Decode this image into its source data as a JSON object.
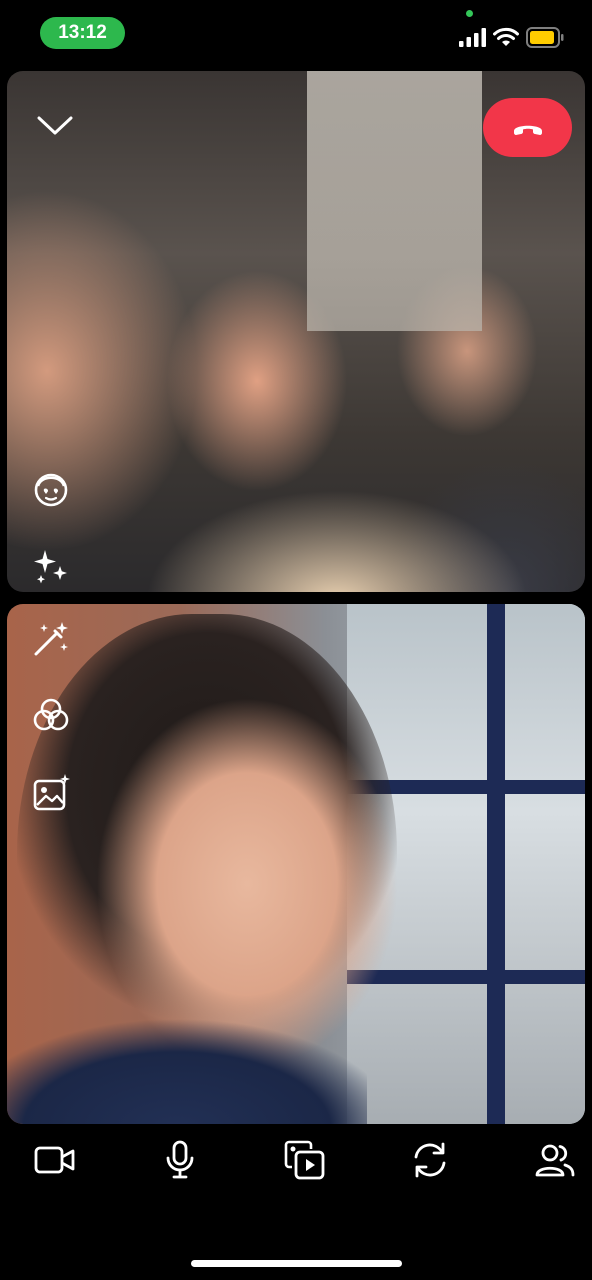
{
  "status_bar": {
    "time": "13:12",
    "icons": [
      "signal-icon",
      "wifi-icon",
      "battery-icon"
    ],
    "time_pill_color": "#2db84d",
    "battery_color": "#ffcc00"
  },
  "call": {
    "end_call_color": "#f23649",
    "tiles": [
      {
        "name": "group-video-feed",
        "icons": [
          "collapse-chevron-icon",
          "phone-hangup-icon",
          "lens-face-icon",
          "sparkles-icon"
        ]
      },
      {
        "name": "self-video-feed",
        "icons": [
          "magic-wand-icon",
          "color-filter-icon",
          "background-image-icon"
        ]
      }
    ]
  },
  "toolbar": {
    "items": [
      "video-camera-icon",
      "microphone-icon",
      "media-share-icon",
      "flip-camera-icon",
      "participants-icon"
    ]
  }
}
